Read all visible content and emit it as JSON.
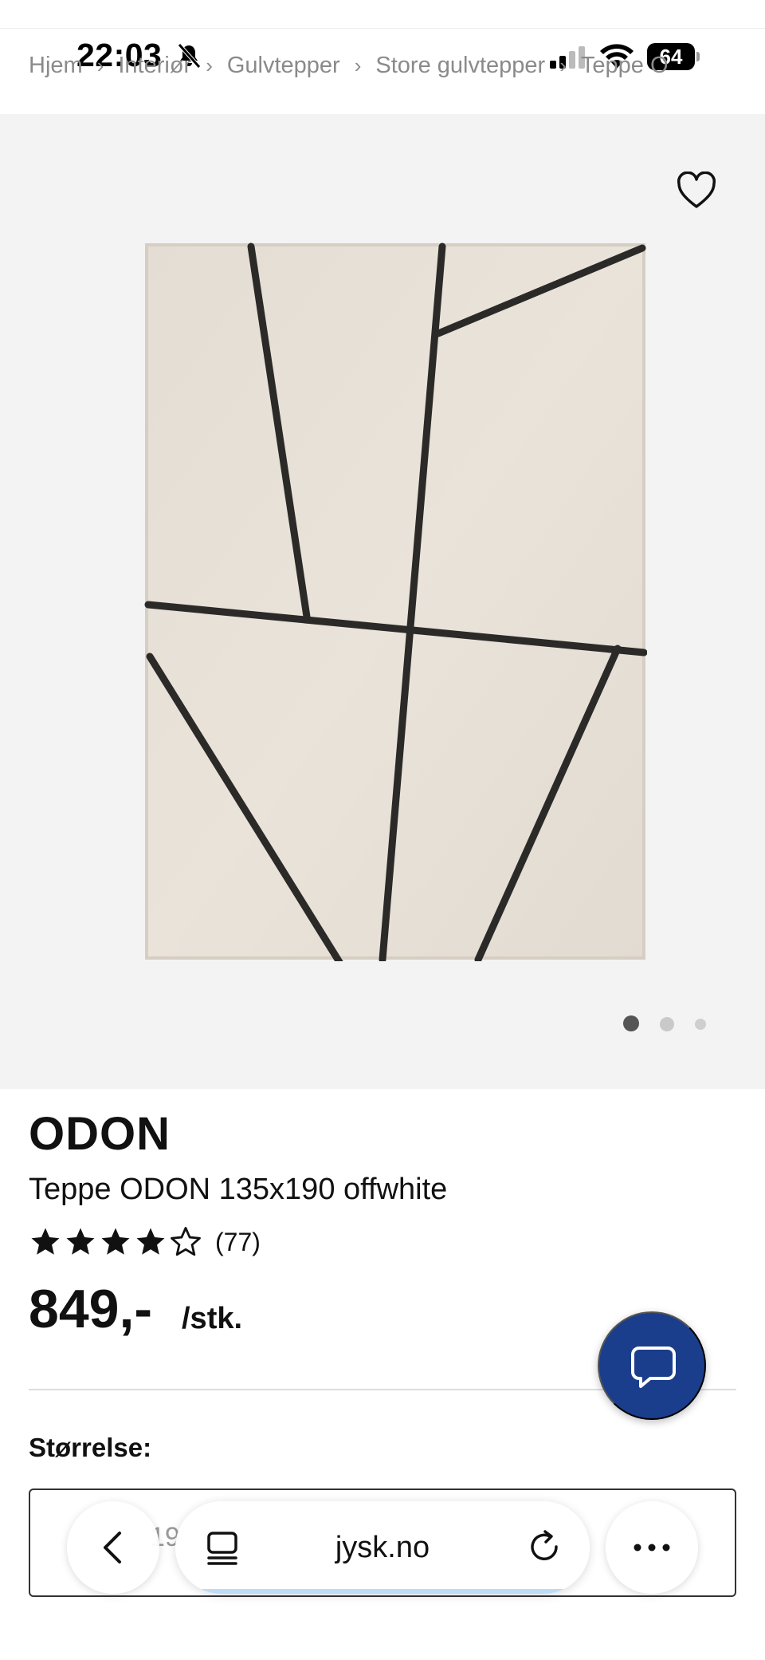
{
  "status_bar": {
    "time": "22:03",
    "battery": "64",
    "bell_icon": "bell-slash-icon",
    "signal_icon": "cellular-signal-icon",
    "wifi_icon": "wifi-icon"
  },
  "breadcrumb": {
    "items": [
      "Hjem",
      "Interiør",
      "Gulvtepper",
      "Store gulvtepper",
      "Teppe O"
    ]
  },
  "gallery": {
    "favorite_icon": "heart-outline-icon",
    "image_count": 3,
    "active_index": 0
  },
  "product": {
    "brand": "ODON",
    "name": "Teppe ODON 135x190 offwhite",
    "rating": 4,
    "rating_max": 5,
    "review_count": "(77)",
    "price": "849,-",
    "unit": "/stk.",
    "size_label": "Størrelse:",
    "size_value_partial": "19"
  },
  "chat": {
    "icon": "chat-bubble-icon",
    "color": "#1b3e8c"
  },
  "browser": {
    "url": "jysk.no",
    "back_icon": "chevron-left-icon",
    "tabs_icon": "tab-overview-icon",
    "reload_icon": "reload-icon",
    "more_icon": "more-dots-icon"
  }
}
